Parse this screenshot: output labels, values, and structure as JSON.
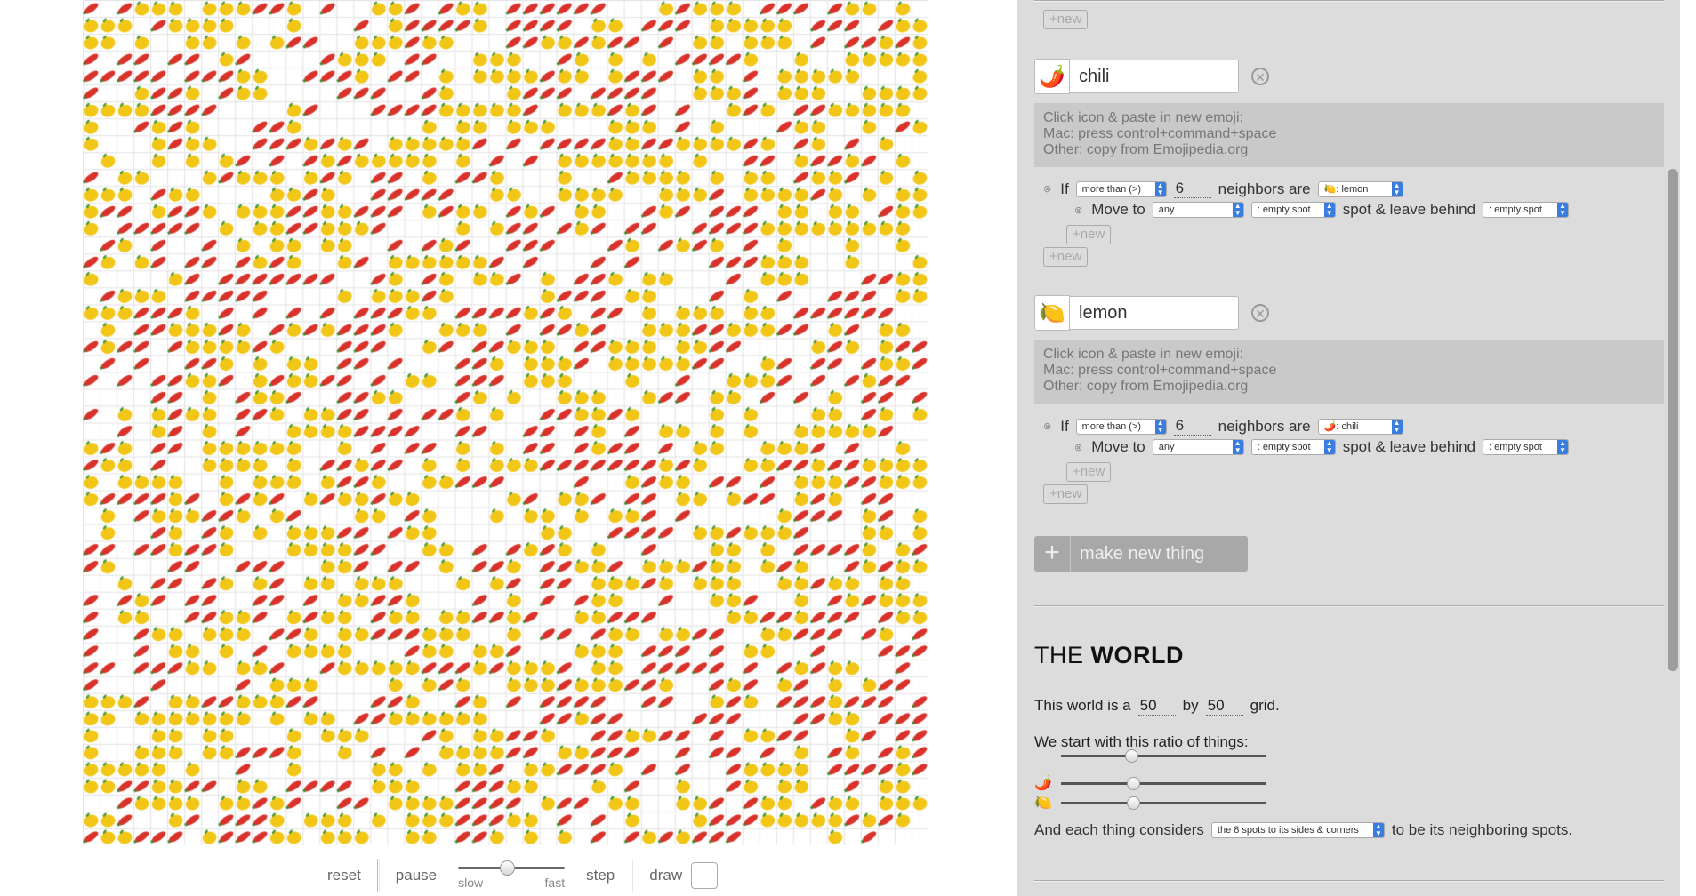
{
  "colors": {
    "chili": "#d8322b",
    "lemon": "#f2c616",
    "panel_bg": "#dcdcdc",
    "select_accent": "#3a7de0"
  },
  "world_grid": {
    "rows": 50,
    "cols": 50
  },
  "controls": {
    "reset": "reset",
    "pause": "pause",
    "slow": "slow",
    "fast": "fast",
    "speed_fraction": 0.45,
    "step": "step",
    "draw": "draw"
  },
  "panel": {
    "top_new_label": "+new",
    "things": [
      {
        "emoji": "🌶️",
        "name": "chili",
        "info": [
          "Click icon & paste in new emoji:",
          "Mac: press control+command+space",
          "Other: copy from Emojipedia.org"
        ],
        "rule": {
          "if_label": "If",
          "comparator": "more than (>)",
          "count": "6",
          "neighbors_label": "neighbors are",
          "neighbor_thing": "🍋: lemon",
          "move_label": "Move to",
          "direction": "any",
          "target": ": empty spot",
          "leave_label": "spot & leave behind",
          "leave": ": empty spot"
        },
        "inner_new": "+new",
        "outer_new": "+new"
      },
      {
        "emoji": "🍋",
        "name": "lemon",
        "info": [
          "Click icon & paste in new emoji:",
          "Mac: press control+command+space",
          "Other: copy from Emojipedia.org"
        ],
        "rule": {
          "if_label": "If",
          "comparator": "more than (>)",
          "count": "6",
          "neighbors_label": "neighbors are",
          "neighbor_thing": "🌶️: chili",
          "move_label": "Move to",
          "direction": "any",
          "target": ": empty spot",
          "leave_label": "spot & leave behind",
          "leave": ": empty spot"
        },
        "inner_new": "+new",
        "outer_new": "+new"
      }
    ],
    "make_new_label": "make new thing",
    "world": {
      "title_the": "THE",
      "title_world": "WORLD",
      "grid_prefix": "This world is a",
      "width": "50",
      "by": "by",
      "height": "50",
      "grid_suffix": "grid.",
      "ratio_label": "We start with this ratio of things:",
      "ratios": [
        {
          "icon": "",
          "value": 0.33
        },
        {
          "icon": "🌶️",
          "value": 0.34
        },
        {
          "icon": "🍋",
          "value": 0.34
        }
      ],
      "neighbors_prefix": "And each thing considers",
      "neighbors_option": "the 8 spots to its sides & corners",
      "neighbors_suffix": "to be its neighboring spots."
    }
  }
}
